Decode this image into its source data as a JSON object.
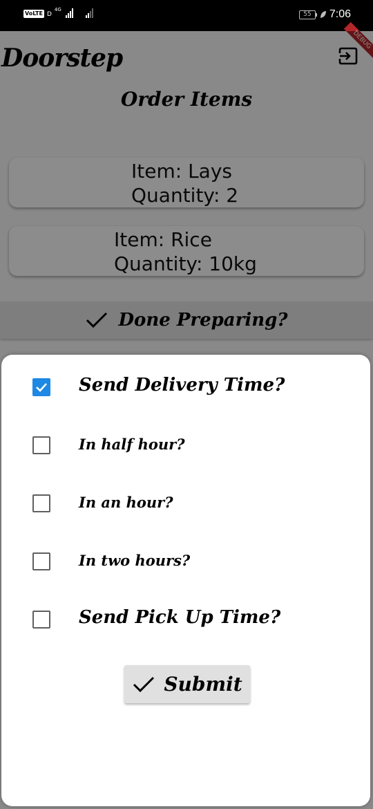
{
  "status_bar": {
    "volte": "VoLTE",
    "network_type": "4G",
    "sim_indicator": "D",
    "battery_level": "55",
    "time": "7:06",
    "icons": [
      "signal-bars-icon",
      "signal-bars-icon",
      "battery-icon",
      "leaf-icon"
    ]
  },
  "app": {
    "title": "Doorstep",
    "logout_icon": "logout-icon",
    "debug_banner": "DEBUG"
  },
  "page": {
    "heading": "Order Items",
    "items": [
      {
        "item_line": "Item: Lays",
        "quantity_line": "Quantity: 2"
      },
      {
        "item_line": "Item: Rice",
        "quantity_line": "Quantity: 10kg"
      }
    ],
    "done_button_label": "Done Preparing?",
    "done_icon": "check-icon"
  },
  "sheet": {
    "options": [
      {
        "label": "Send Delivery Time?",
        "checked": true
      },
      {
        "label": "In half hour?",
        "checked": false
      },
      {
        "label": "In an hour?",
        "checked": false
      },
      {
        "label": "In two hours?",
        "checked": false
      },
      {
        "label": "Send Pick Up Time?",
        "checked": false
      }
    ],
    "submit_label": "Submit",
    "submit_icon": "check-icon"
  },
  "colors": {
    "checkbox_accent": "#1e88e5",
    "scrim": "rgba(0,0,0,0.45)",
    "debug_ribbon": "#b3262a"
  }
}
